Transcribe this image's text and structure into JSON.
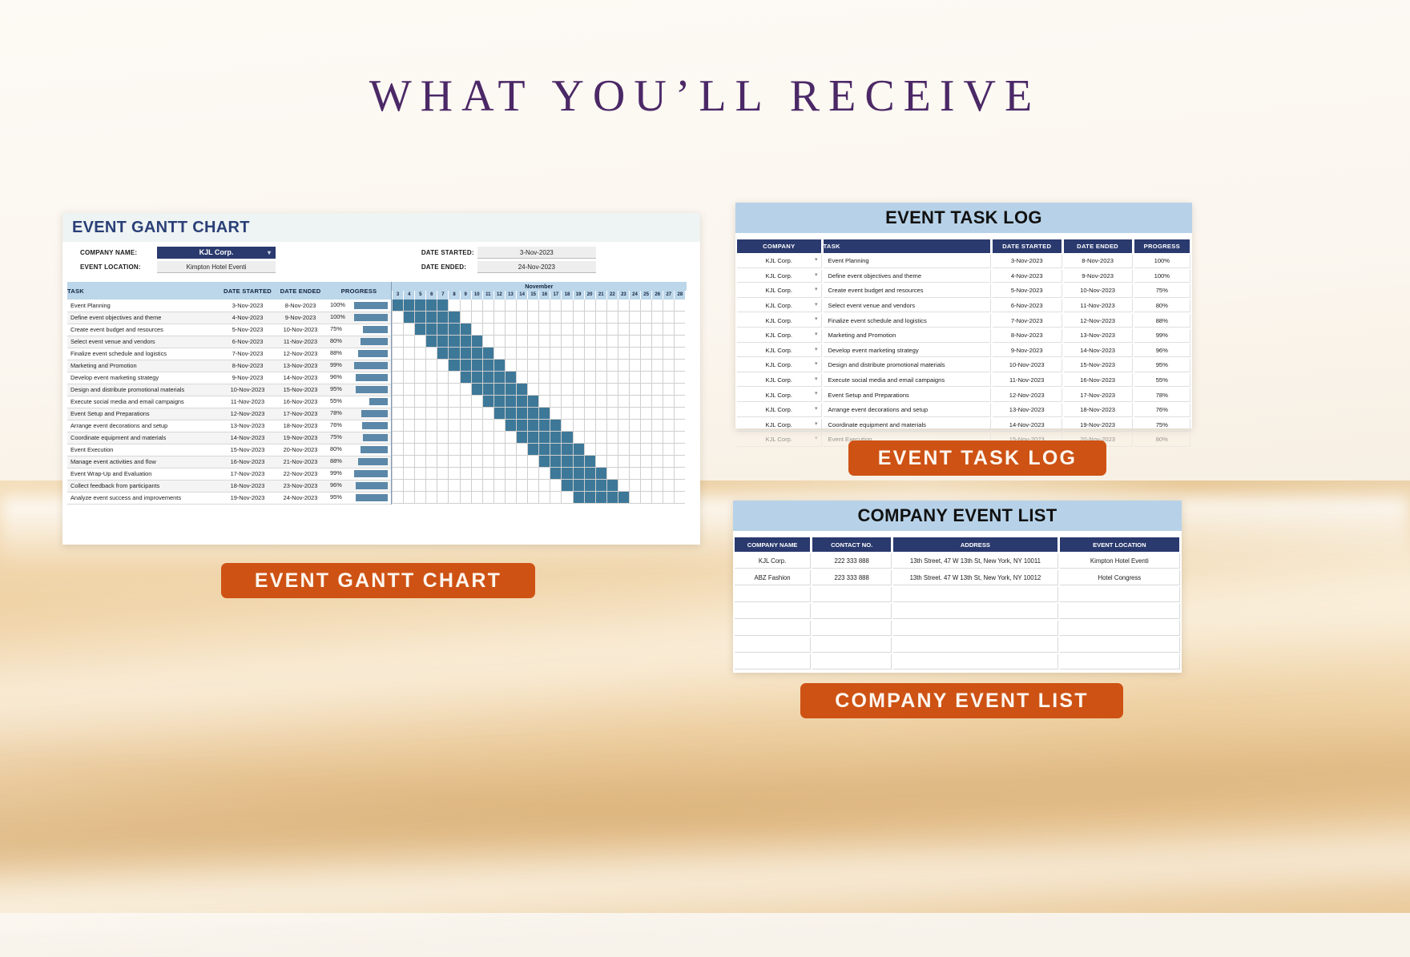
{
  "page": {
    "heading": "WHAT YOU’LL RECEIVE"
  },
  "colors": {
    "navy": "#2a3a6e",
    "light_blue": "#b7d2e8",
    "orange": "#ce5214",
    "bar_blue": "#5b88a8",
    "gantt_fill": "#3d7898",
    "heading_purple": "#4b2866"
  },
  "gantt": {
    "title": "EVENT GANTT CHART",
    "meta": {
      "company_name_label": "COMPANY NAME:",
      "company_name_value": "KJL Corp.",
      "event_location_label": "EVENT LOCATION:",
      "event_location_value": "Kimpton Hotel Eventi",
      "date_started_label": "DATE STARTED:",
      "date_started_value": "3-Nov-2023",
      "date_ended_label": "DATE ENDED:",
      "date_ended_value": "24-Nov-2023",
      "dropdown_caret": "▾"
    },
    "columns": [
      "TASK",
      "DATE STARTED",
      "DATE ENDED",
      "PROGRESS"
    ],
    "month_label": "November",
    "days": [
      3,
      4,
      5,
      6,
      7,
      8,
      9,
      10,
      11,
      12,
      13,
      14,
      15,
      16,
      17,
      18,
      19,
      20,
      21,
      22,
      23,
      24,
      25,
      26,
      27,
      28
    ],
    "rows": [
      {
        "task": "Event Planning",
        "start": "3-Nov-2023",
        "end": "8-Nov-2023",
        "progress": "100%",
        "bar_start_day": 3,
        "bar_end_day": 8,
        "progress_pct": 100
      },
      {
        "task": "Define event objectives and theme",
        "start": "4-Nov-2023",
        "end": "9-Nov-2023",
        "progress": "100%",
        "bar_start_day": 4,
        "bar_end_day": 9,
        "progress_pct": 100
      },
      {
        "task": "Create event budget and resources",
        "start": "5-Nov-2023",
        "end": "10-Nov-2023",
        "progress": "75%",
        "bar_start_day": 5,
        "bar_end_day": 10,
        "progress_pct": 75
      },
      {
        "task": "Select event venue and vendors",
        "start": "6-Nov-2023",
        "end": "11-Nov-2023",
        "progress": "80%",
        "bar_start_day": 6,
        "bar_end_day": 11,
        "progress_pct": 80
      },
      {
        "task": "Finalize event schedule and logistics",
        "start": "7-Nov-2023",
        "end": "12-Nov-2023",
        "progress": "88%",
        "bar_start_day": 7,
        "bar_end_day": 12,
        "progress_pct": 88
      },
      {
        "task": "Marketing and Promotion",
        "start": "8-Nov-2023",
        "end": "13-Nov-2023",
        "progress": "99%",
        "bar_start_day": 8,
        "bar_end_day": 13,
        "progress_pct": 99
      },
      {
        "task": "Develop event marketing strategy",
        "start": "9-Nov-2023",
        "end": "14-Nov-2023",
        "progress": "96%",
        "bar_start_day": 9,
        "bar_end_day": 14,
        "progress_pct": 96
      },
      {
        "task": "Design and distribute promotional materials",
        "start": "10-Nov-2023",
        "end": "15-Nov-2023",
        "progress": "95%",
        "bar_start_day": 10,
        "bar_end_day": 15,
        "progress_pct": 95
      },
      {
        "task": "Execute social media and email campaigns",
        "start": "11-Nov-2023",
        "end": "16-Nov-2023",
        "progress": "55%",
        "bar_start_day": 11,
        "bar_end_day": 16,
        "progress_pct": 55
      },
      {
        "task": "Event Setup and Preparations",
        "start": "12-Nov-2023",
        "end": "17-Nov-2023",
        "progress": "78%",
        "bar_start_day": 12,
        "bar_end_day": 17,
        "progress_pct": 78
      },
      {
        "task": "Arrange event decorations and setup",
        "start": "13-Nov-2023",
        "end": "18-Nov-2023",
        "progress": "76%",
        "bar_start_day": 13,
        "bar_end_day": 18,
        "progress_pct": 76
      },
      {
        "task": "Coordinate equipment and materials",
        "start": "14-Nov-2023",
        "end": "19-Nov-2023",
        "progress": "75%",
        "bar_start_day": 14,
        "bar_end_day": 19,
        "progress_pct": 75
      },
      {
        "task": "Event Execution",
        "start": "15-Nov-2023",
        "end": "20-Nov-2023",
        "progress": "80%",
        "bar_start_day": 15,
        "bar_end_day": 20,
        "progress_pct": 80
      },
      {
        "task": "Manage event activities and flow",
        "start": "16-Nov-2023",
        "end": "21-Nov-2023",
        "progress": "88%",
        "bar_start_day": 16,
        "bar_end_day": 21,
        "progress_pct": 88
      },
      {
        "task": "Event Wrap-Up and Evaluation",
        "start": "17-Nov-2023",
        "end": "22-Nov-2023",
        "progress": "99%",
        "bar_start_day": 17,
        "bar_end_day": 22,
        "progress_pct": 99
      },
      {
        "task": "Collect feedback from participants",
        "start": "18-Nov-2023",
        "end": "23-Nov-2023",
        "progress": "96%",
        "bar_start_day": 18,
        "bar_end_day": 23,
        "progress_pct": 96
      },
      {
        "task": "Analyze event success and improvements",
        "start": "19-Nov-2023",
        "end": "24-Nov-2023",
        "progress": "95%",
        "bar_start_day": 19,
        "bar_end_day": 24,
        "progress_pct": 95
      }
    ]
  },
  "task_log": {
    "title": "EVENT TASK LOG",
    "columns": [
      "COMPANY",
      "TASK",
      "DATE STARTED",
      "DATE ENDED",
      "PROGRESS"
    ],
    "dropdown_caret": "▾",
    "rows": [
      {
        "company": "KJL Corp.",
        "task": "Event Planning",
        "start": "3-Nov-2023",
        "end": "8-Nov-2023",
        "progress": "100%"
      },
      {
        "company": "KJL Corp.",
        "task": "Define event objectives and theme",
        "start": "4-Nov-2023",
        "end": "9-Nov-2023",
        "progress": "100%"
      },
      {
        "company": "KJL Corp.",
        "task": "Create event budget and resources",
        "start": "5-Nov-2023",
        "end": "10-Nov-2023",
        "progress": "75%"
      },
      {
        "company": "KJL Corp.",
        "task": "Select event venue and vendors",
        "start": "6-Nov-2023",
        "end": "11-Nov-2023",
        "progress": "80%"
      },
      {
        "company": "KJL Corp.",
        "task": "Finalize event schedule and logistics",
        "start": "7-Nov-2023",
        "end": "12-Nov-2023",
        "progress": "88%"
      },
      {
        "company": "KJL Corp.",
        "task": "Marketing and Promotion",
        "start": "8-Nov-2023",
        "end": "13-Nov-2023",
        "progress": "99%"
      },
      {
        "company": "KJL Corp.",
        "task": "Develop event marketing strategy",
        "start": "9-Nov-2023",
        "end": "14-Nov-2023",
        "progress": "96%"
      },
      {
        "company": "KJL Corp.",
        "task": "Design and distribute promotional materials",
        "start": "10-Nov-2023",
        "end": "15-Nov-2023",
        "progress": "95%"
      },
      {
        "company": "KJL Corp.",
        "task": "Execute social media and email campaigns",
        "start": "11-Nov-2023",
        "end": "16-Nov-2023",
        "progress": "55%"
      },
      {
        "company": "KJL Corp.",
        "task": "Event Setup and Preparations",
        "start": "12-Nov-2023",
        "end": "17-Nov-2023",
        "progress": "78%"
      },
      {
        "company": "KJL Corp.",
        "task": "Arrange event decorations and setup",
        "start": "13-Nov-2023",
        "end": "18-Nov-2023",
        "progress": "76%"
      },
      {
        "company": "KJL Corp.",
        "task": "Coordinate equipment and materials",
        "start": "14-Nov-2023",
        "end": "19-Nov-2023",
        "progress": "75%"
      },
      {
        "company": "KJL Corp.",
        "task": "Event Execution",
        "start": "15-Nov-2023",
        "end": "20-Nov-2023",
        "progress": "80%"
      }
    ]
  },
  "company_list": {
    "title": "COMPANY EVENT LIST",
    "columns": [
      "COMPANY NAME",
      "CONTACT NO.",
      "ADDRESS",
      "EVENT LOCATION"
    ],
    "rows": [
      {
        "name": "KJL Corp.",
        "contact": "222 333 888",
        "address": "13th Street, 47 W 13th St, New York, NY 10011",
        "location": "Kimpton Hotel Eventi"
      },
      {
        "name": "ABZ Fashion",
        "contact": "223 333 888",
        "address": "13th Street. 47 W 13th St, New York, NY 10012",
        "location": "Hotel Congress"
      },
      {
        "name": "",
        "contact": "",
        "address": "",
        "location": ""
      },
      {
        "name": "",
        "contact": "",
        "address": "",
        "location": ""
      },
      {
        "name": "",
        "contact": "",
        "address": "",
        "location": ""
      },
      {
        "name": "",
        "contact": "",
        "address": "",
        "location": ""
      },
      {
        "name": "",
        "contact": "",
        "address": "",
        "location": ""
      }
    ]
  },
  "badges": {
    "gantt": "EVENT GANTT CHART",
    "task_log": "EVENT TASK LOG",
    "company_list": "COMPANY EVENT LIST"
  }
}
